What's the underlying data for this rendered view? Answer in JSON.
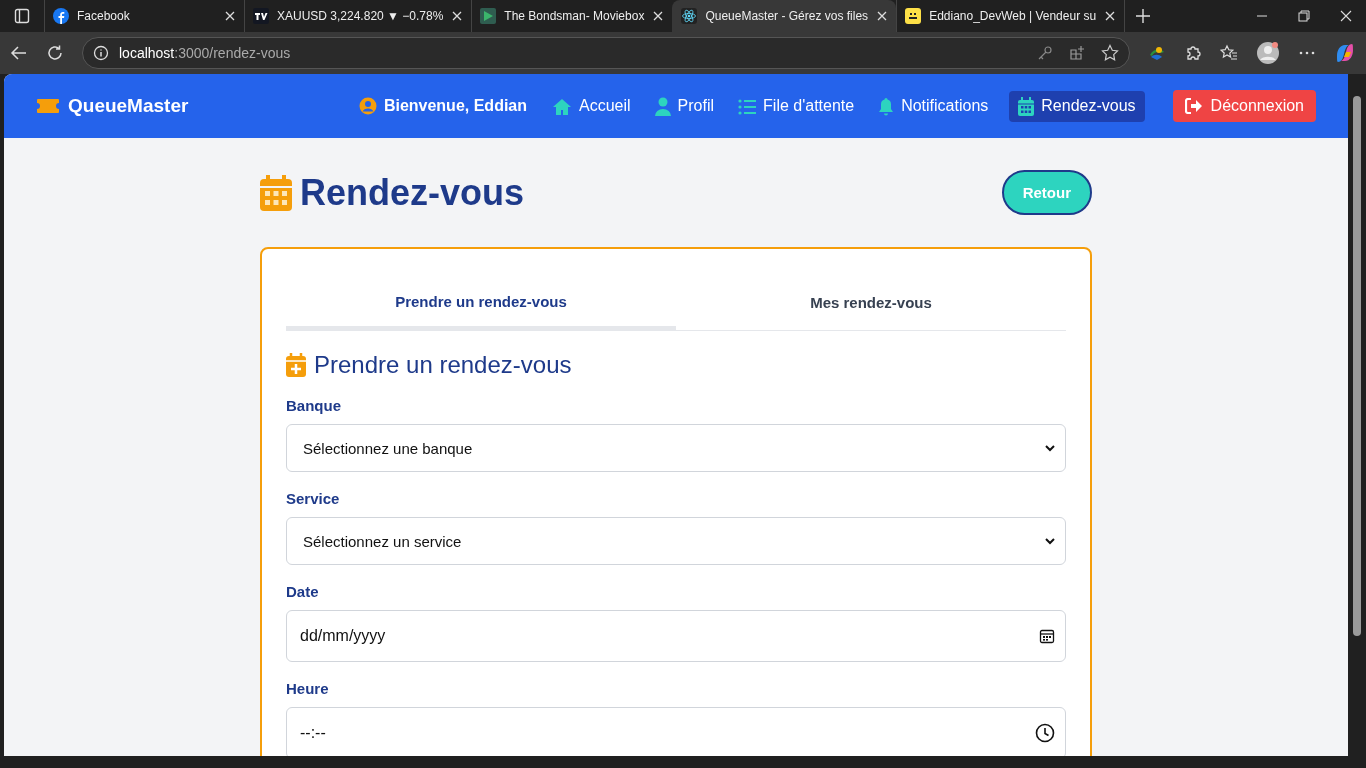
{
  "browser": {
    "tabs": [
      {
        "title": "Facebook",
        "kind": "facebook",
        "selected": false
      },
      {
        "title": "XAUUSD 3,224.820 ▼ −0.78%",
        "kind": "tv",
        "selected": false
      },
      {
        "title": "The Bondsman- Moviebox",
        "kind": "play",
        "selected": false
      },
      {
        "title": "QueueMaster - Gérez vos files",
        "kind": "react",
        "selected": true
      },
      {
        "title": "Eddiano_DevWeb | Vendeur su",
        "kind": "yellow",
        "selected": false
      }
    ],
    "address": {
      "host": "localhost",
      "path": ":3000/rendez-vous"
    }
  },
  "navbar": {
    "brand": "QueueMaster",
    "greeting": "Bienvenue, Eddian",
    "items": [
      {
        "label": "Accueil",
        "kind": "home",
        "selected": false
      },
      {
        "label": "Profil",
        "kind": "user",
        "selected": false
      },
      {
        "label": "File d'attente",
        "kind": "list",
        "selected": false
      },
      {
        "label": "Notifications",
        "kind": "bell",
        "selected": false
      },
      {
        "label": "Rendez-vous",
        "kind": "calendar",
        "selected": true
      }
    ],
    "logout": "Déconnexion"
  },
  "page": {
    "title": "Rendez-vous",
    "back_button": "Retour",
    "tabs": [
      {
        "label": "Prendre un rendez-vous",
        "selected": true
      },
      {
        "label": "Mes rendez-vous",
        "selected": false
      }
    ],
    "section_title": "Prendre un rendez-vous",
    "fields": [
      {
        "label": "Banque",
        "kind": "select",
        "value": "Sélectionnez une banque"
      },
      {
        "label": "Service",
        "kind": "select",
        "value": "Sélectionnez un service"
      },
      {
        "label": "Date",
        "kind": "date",
        "value": "dd/mm/yyyy"
      },
      {
        "label": "Heure",
        "kind": "time",
        "value": "--:--"
      }
    ]
  }
}
